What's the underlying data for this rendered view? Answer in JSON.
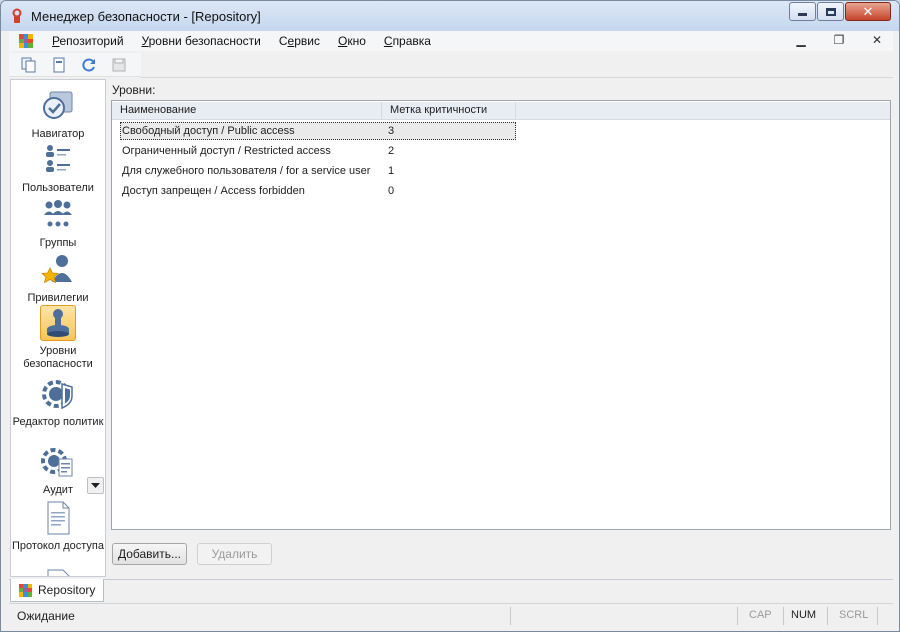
{
  "window": {
    "title": "Менеджер безопасности - [Repository]"
  },
  "menu": {
    "items": [
      {
        "pre": "",
        "ul": "Р",
        "rest": "епозиторий"
      },
      {
        "pre": "",
        "ul": "У",
        "rest": "ровни безопасности"
      },
      {
        "pre": "С",
        "ul": "е",
        "rest": "рвис"
      },
      {
        "pre": "",
        "ul": "О",
        "rest": "кно"
      },
      {
        "pre": "",
        "ul": "С",
        "rest": "правка"
      }
    ]
  },
  "navigator": {
    "items": [
      {
        "label": "Навигатор",
        "icon": "navigator-icon"
      },
      {
        "label": "Пользователи",
        "icon": "users-icon"
      },
      {
        "label": "Группы",
        "icon": "groups-icon"
      },
      {
        "label": "Привилегии",
        "icon": "privileges-icon"
      },
      {
        "label": "Уровни безопасности",
        "icon": "security-levels-icon"
      },
      {
        "label": "Редактор политик",
        "icon": "policy-editor-icon"
      },
      {
        "label": "Аудит",
        "icon": "audit-icon"
      },
      {
        "label": "Протокол доступа",
        "icon": "access-log-icon"
      }
    ]
  },
  "content": {
    "levels_label": "Уровни:",
    "columns": [
      "Наименование",
      "Метка критичности"
    ],
    "rows": [
      {
        "name": "Свободный доступ / Public access",
        "mark": "3"
      },
      {
        "name": "Ограниченный доступ / Restricted access",
        "mark": "2"
      },
      {
        "name": "Для служебного пользователя / for a service user",
        "mark": "1"
      },
      {
        "name": "Доступ запрещен / Access forbidden",
        "mark": "0"
      }
    ],
    "add_button": "Добавить...",
    "delete_button": "Удалить"
  },
  "doc_tab": {
    "label": "Repository"
  },
  "status": {
    "text": "Ожидание",
    "cap": "CAP",
    "num": "NUM",
    "scrl": "SCRL"
  },
  "colors": {
    "accent": "#f8c45a",
    "icon_blue": "#4f6f9b",
    "selection": "#eaeaea"
  }
}
